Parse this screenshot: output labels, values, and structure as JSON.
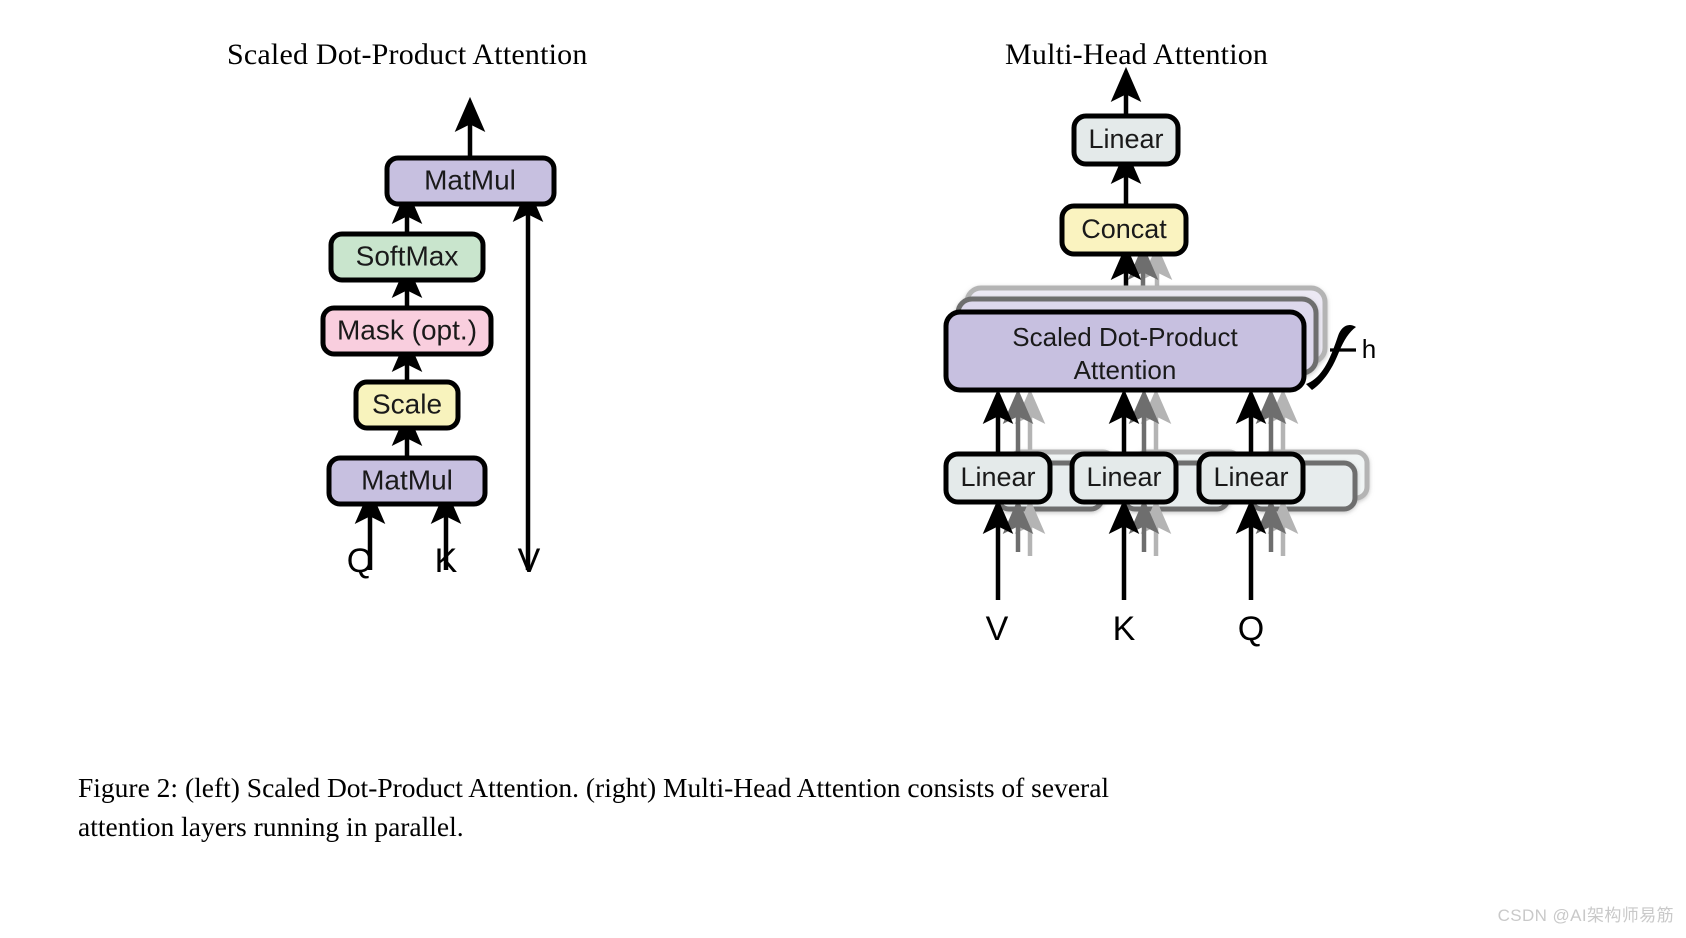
{
  "panels": {
    "left": {
      "title": "Scaled Dot-Product Attention",
      "blocks": [
        {
          "id": "matmul-top",
          "label": "MatMul",
          "color": "#c7c0e0"
        },
        {
          "id": "softmax",
          "label": "SoftMax",
          "color": "#c9e5cd"
        },
        {
          "id": "mask",
          "label": "Mask (opt.)",
          "color": "#f9cede"
        },
        {
          "id": "scale",
          "label": "Scale",
          "color": "#f8f3bd"
        },
        {
          "id": "matmul-bot",
          "label": "MatMul",
          "color": "#c7c0e0"
        }
      ],
      "inputs": [
        "Q",
        "K",
        "V"
      ]
    },
    "right": {
      "title": "Multi-Head Attention",
      "blocks": [
        {
          "id": "linear-out",
          "label": "Linear",
          "color": "#e4eaea"
        },
        {
          "id": "concat",
          "label": "Concat",
          "color": "#faf3c0"
        },
        {
          "id": "sdpa",
          "label": "Scaled Dot-Product\nAttention",
          "line1": "Scaled Dot-Product",
          "line2": "Attention",
          "color": "#c7c0e0"
        },
        {
          "id": "linear-v",
          "label": "Linear",
          "color": "#e4eaea"
        },
        {
          "id": "linear-k",
          "label": "Linear",
          "color": "#e4eaea"
        },
        {
          "id": "linear-q",
          "label": "Linear",
          "color": "#e4eaea"
        }
      ],
      "heads_label": "h",
      "inputs": [
        "V",
        "K",
        "Q"
      ]
    }
  },
  "caption": {
    "line1": "Figure 2:  (left) Scaled Dot-Product Attention.  (right) Multi-Head Attention consists of several",
    "line2": "attention layers running in parallel."
  },
  "watermark": {
    "text": "CSDN @AI架构师易筋"
  },
  "colors": {
    "purple": "#c7c0e0",
    "green": "#c9e5cd",
    "pink": "#f9cede",
    "yellow": "#f8f3bd",
    "gray_blue": "#e4eaea",
    "outline": "#000000",
    "ghost1": "#6e6e6e",
    "ghost2": "#a8a8a8"
  }
}
